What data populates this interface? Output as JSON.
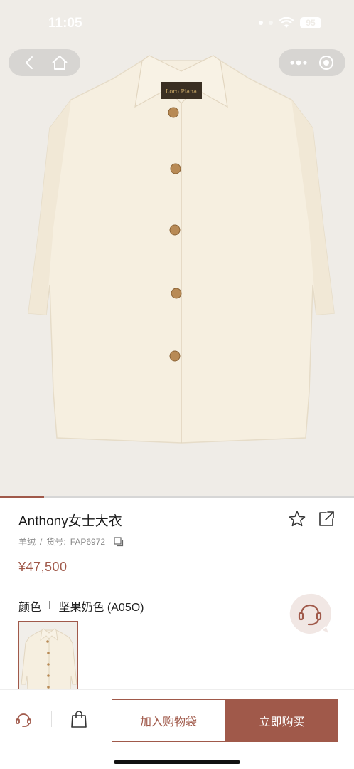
{
  "status_bar": {
    "time": "11:05",
    "battery": "95"
  },
  "hero": {
    "progress_fraction": 0.125
  },
  "product": {
    "title": "Anthony女士大衣",
    "material": "羊绒",
    "sku_label": "货号:",
    "sku": "FAP6972",
    "price": "¥47,500",
    "color_label": "颜色",
    "color_sep": "I",
    "color_value": "坚果奶色 (A05O)"
  },
  "actions": {
    "add_to_cart": "加入购物袋",
    "buy_now": "立即购买"
  },
  "colors": {
    "accent": "#a0594a",
    "hero_bg": "#efece7",
    "coat": "#f6efe0"
  },
  "icons": [
    "back-icon",
    "home-icon",
    "more-icon",
    "capsule-close-icon",
    "star-icon",
    "share-icon",
    "copy-icon",
    "customer-service-icon",
    "advisor-icon",
    "shopping-bag-icon"
  ]
}
